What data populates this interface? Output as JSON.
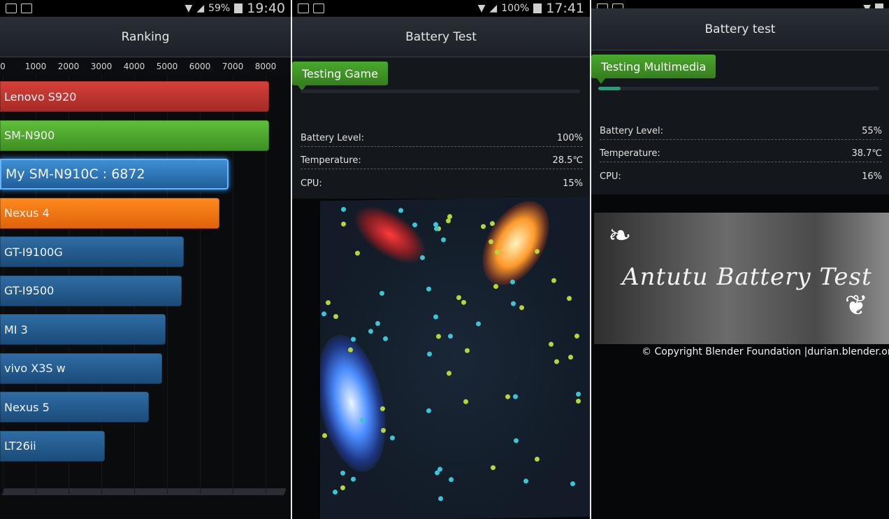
{
  "colors": {
    "bar_red": "#c0342f",
    "bar_green": "#4fae2e",
    "bar_mine": "#2f7fc4",
    "bar_orange": "#f57410",
    "bar_blue": "#24588a",
    "testing_green": "#3f9624"
  },
  "screen1": {
    "status": {
      "battery": "59%",
      "clock": "19:40"
    },
    "title": "Ranking",
    "axis_ticks": [
      "0",
      "1000",
      "2000",
      "3000",
      "4000",
      "5000",
      "6000",
      "7000",
      "8000"
    ],
    "rows": [
      {
        "label": "Lenovo S920",
        "value": 8100,
        "style": "red"
      },
      {
        "label": "SM-N900",
        "value": 8100,
        "style": "green"
      },
      {
        "label": "My SM-N910C :  6872",
        "value": 6872,
        "style": "mine"
      },
      {
        "label": "Nexus 4",
        "value": 6600,
        "style": "orange"
      },
      {
        "label": "GT-I9100G",
        "value": 5500,
        "style": "blue"
      },
      {
        "label": "GT-I9500",
        "value": 5450,
        "style": "blue"
      },
      {
        "label": "MI 3",
        "value": 4950,
        "style": "blue"
      },
      {
        "label": "vivo X3S w",
        "value": 4850,
        "style": "blue"
      },
      {
        "label": "Nexus 5",
        "value": 4450,
        "style": "blue"
      },
      {
        "label": "LT26ii",
        "value": 3100,
        "style": "blue"
      }
    ]
  },
  "screen2": {
    "status": {
      "battery": "100%",
      "clock": "17:41"
    },
    "title": "Battery Test",
    "testing_label": "Testing Game",
    "progress": 0,
    "stats": [
      {
        "label": "Battery Level:",
        "value": "100%"
      },
      {
        "label": "Temperature:",
        "value": "28.5℃"
      },
      {
        "label": "CPU:",
        "value": "15%"
      }
    ]
  },
  "screen3": {
    "title": "Battery test",
    "testing_label": "Testing Multimedia",
    "progress": 0.08,
    "stats": [
      {
        "label": "Battery Level:",
        "value": "55%"
      },
      {
        "label": "Temperature:",
        "value": "38.7℃"
      },
      {
        "label": "CPU:",
        "value": "16%"
      }
    ],
    "banner_title": "Antutu Battery Test",
    "copyright": "© Copyright Blender Foundation |durian.blender.org"
  },
  "icons": [
    "screenshot-icon",
    "gallery-icon",
    "wifi-icon",
    "signal-icon",
    "battery-icon"
  ]
}
